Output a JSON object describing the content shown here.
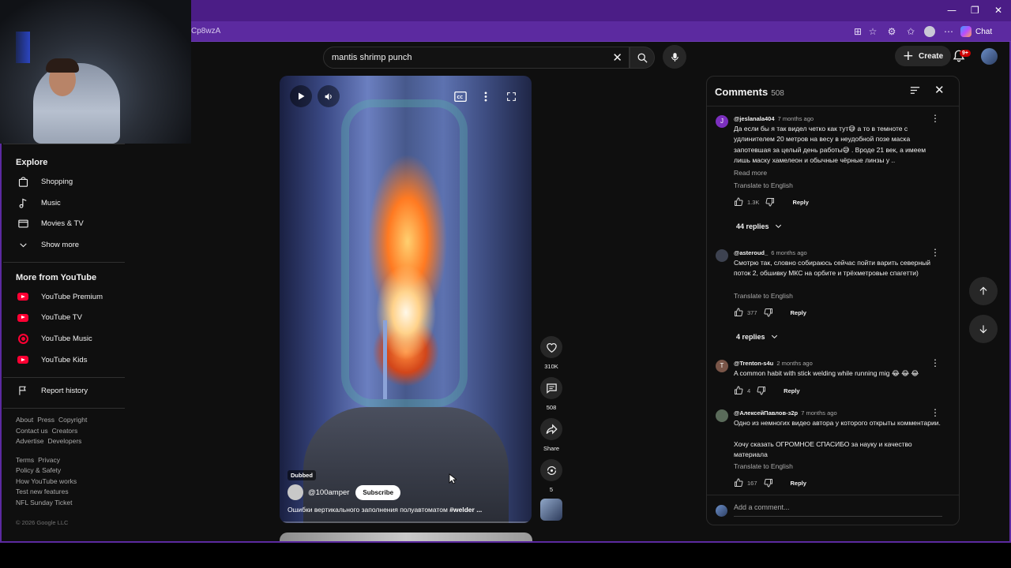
{
  "browser": {
    "address_fragment": "Cp8wzA",
    "chat_label": "Chat",
    "window_controls": [
      "—",
      "❐",
      "✕"
    ]
  },
  "header": {
    "search_query": "mantis shrimp punch",
    "create_label": "Create",
    "notification_badge": "9+"
  },
  "sidebar": {
    "explore_title": "Explore",
    "explore_items": [
      {
        "label": "Shopping",
        "icon": "shopping-bag-icon"
      },
      {
        "label": "Music",
        "icon": "music-note-icon"
      },
      {
        "label": "Movies & TV",
        "icon": "film-icon"
      },
      {
        "label": "Show more",
        "icon": "chevron-down-icon"
      }
    ],
    "more_title": "More from YouTube",
    "more_items": [
      {
        "label": "YouTube Premium",
        "icon": "youtube-premium-icon"
      },
      {
        "label": "YouTube TV",
        "icon": "youtube-tv-icon"
      },
      {
        "label": "YouTube Music",
        "icon": "youtube-music-icon"
      },
      {
        "label": "YouTube Kids",
        "icon": "youtube-kids-icon"
      }
    ],
    "report_history": "Report history",
    "footer_row1": [
      "About",
      "Press",
      "Copyright"
    ],
    "footer_row2": [
      "Contact us",
      "Creators"
    ],
    "footer_row3": [
      "Advertise",
      "Developers"
    ],
    "footer_row4": [
      "Terms",
      "Privacy"
    ],
    "footer_row5": [
      "Policy & Safety"
    ],
    "footer_row6": [
      "How YouTube works"
    ],
    "footer_row7": [
      "Test new features"
    ],
    "footer_row8": [
      "NFL Sunday Ticket"
    ],
    "copyright": "© 2026 Google LLC"
  },
  "video": {
    "badge": "Dubbed",
    "channel": "@100amper",
    "subscribe_label": "Subscribe",
    "title_text": "Ошибки вертикального заполнения полуавтоматом ",
    "title_tag": "#welder ..."
  },
  "actions": {
    "likes": "310K",
    "comments": "508",
    "share": "Share",
    "remix": "5"
  },
  "comments": {
    "title": "Comments",
    "count": "508",
    "add_placeholder": "Add a comment...",
    "items": [
      {
        "author": "@jeslanala404",
        "ago": "7 months ago",
        "avatar_letter": "J",
        "avatar_color": "#7b2fbe",
        "text": "Да если бы я так видел четко как тут😅 а то в темноте с удлинителем 20 метров на весу в неудобной позе маска запотевшая за целый день работы😅 . Вроде 21 век, а имеем лишь маску хамелеон и обычные чёрные линзы у ..",
        "read_more": "Read more",
        "translate": "Translate to English",
        "likes": "1.3K",
        "reply": "Reply",
        "replies": "44 replies"
      },
      {
        "author": "@asteroud_",
        "ago": "6 months ago",
        "avatar_letter": "",
        "avatar_color": "#3d4250",
        "text": "Смотрю так, словно собираюсь сейчас пойти варить северный поток 2, обшивку МКС на орбите и трёхметровые спагетти)",
        "translate": "Translate to English",
        "likes": "377",
        "reply": "Reply",
        "replies": "4 replies"
      },
      {
        "author": "@Trenton-s4u",
        "ago": "2 months ago",
        "avatar_letter": "T",
        "avatar_color": "#795548",
        "text": "A common habit with stick welding while running mig 😂 😂 😂",
        "likes": "4",
        "reply": "Reply"
      },
      {
        "author": "@АлексейПавлов-з2р",
        "ago": "7 months ago",
        "avatar_letter": "",
        "avatar_color": "#5a6b5a",
        "text": "Одно из немногих видео автора у которого открыты комментарии.",
        "text2": "Хочу сказать ОГРОМНОЕ СПАСИБО за науку и качество материала",
        "translate": "Translate to English",
        "likes": "167",
        "reply": "Reply"
      }
    ]
  }
}
